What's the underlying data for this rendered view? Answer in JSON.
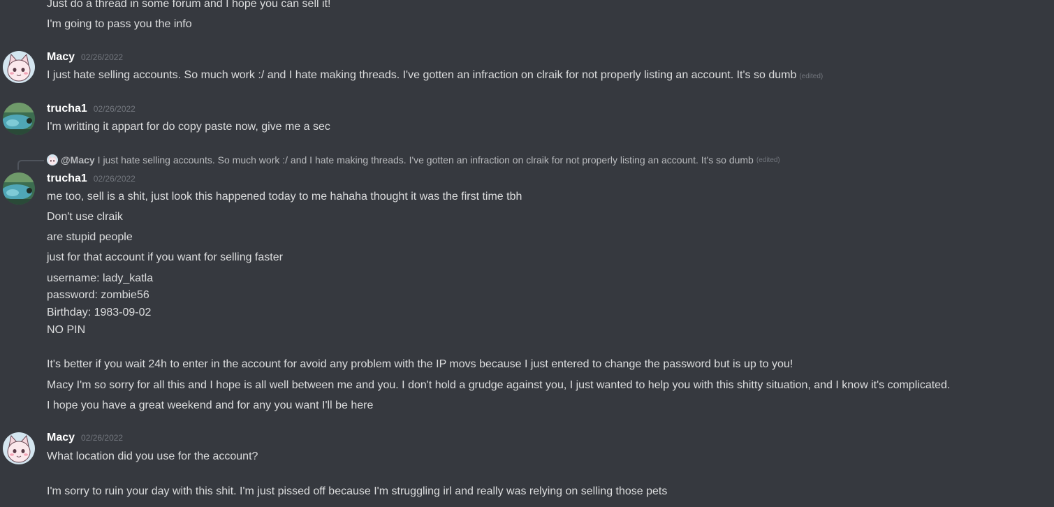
{
  "colors": {
    "background": "#36393f",
    "text": "#dcddde",
    "username": "#ffffff",
    "timestamp": "#72767d"
  },
  "messages": [
    {
      "continuation_lines": [
        "Just do a thread in some forum and I hope you can sell it!",
        "I'm going to pass you the info"
      ]
    },
    {
      "author": "Macy",
      "avatar_icon": "cat-avatar-icon",
      "timestamp": "02/26/2022",
      "text": "I just hate selling accounts. So much work :/ and I hate making threads. I've gotten an infraction on clraik for not properly listing an account. It's so dumb",
      "edited": "(edited)"
    },
    {
      "author": "trucha1",
      "avatar_icon": "landscape-avatar-icon",
      "timestamp": "02/26/2022",
      "text": "I'm writting it appart for do copy paste now, give me a sec"
    },
    {
      "reply": {
        "mention": "@Macy",
        "text": "I just hate selling accounts. So much work :/ and I hate making threads. I've gotten an infraction on clraik for not properly listing an account. It's so dumb",
        "edited": "(edited)"
      },
      "author": "trucha1",
      "avatar_icon": "landscape-avatar-icon",
      "timestamp": "02/26/2022",
      "lines": [
        "me too, sell is a shit, just look this happened today to me hahaha thought it was the first time tbh",
        "Don't use clraik",
        "are stupid people",
        "just for that account if you want for selling faster",
        "username: lady_katla",
        "password: zombie56",
        "Birthday: 1983-09-02",
        "NO PIN",
        "It's better if you wait 24h to enter in the account for avoid any problem with the IP movs because I just entered to change the password but is up to you!",
        "Macy I'm so sorry for all this and I hope is all well between me and you. I don't hold a grudge against you, I just wanted to help you with this shitty situation, and I know it's complicated.",
        "I hope you have a great weekend and for any you want I'll be here"
      ]
    },
    {
      "author": "Macy",
      "avatar_icon": "cat-avatar-icon",
      "timestamp": "02/26/2022",
      "lines": [
        "What location did you use for the account?",
        "I'm sorry to ruin your day with this shit. I'm just pissed off because I'm struggling irl and really was relying on selling those pets"
      ]
    }
  ]
}
